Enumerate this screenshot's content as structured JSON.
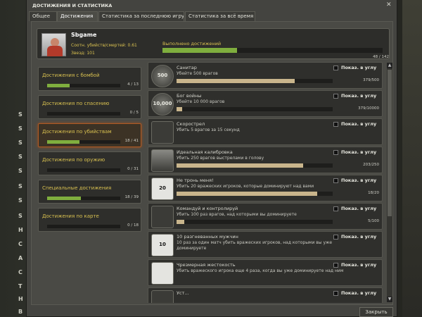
{
  "window": {
    "title": "ДОСТИЖЕНИЯ И СТАТИСТИКА",
    "close_label": "Закрыть"
  },
  "tabs": [
    {
      "label": "Общее"
    },
    {
      "label": "Достижения"
    },
    {
      "label": "Статистика за последнюю игру"
    },
    {
      "label": "Статистика за всё время"
    }
  ],
  "background_menu": [
    "S",
    "S",
    "S",
    "S",
    "S",
    "S",
    "S",
    "S",
    "H",
    "C",
    "A",
    "C",
    "T",
    "H",
    "B"
  ],
  "profile": {
    "name": "Sbgame",
    "kd_label": "Соотн. убийств/смертей: 0.61",
    "stars_label": "Звезд: 101",
    "achievements_label": "Выполнено достижений",
    "achievements_count": "48 / 142",
    "achievements_progress": 0.338
  },
  "categories": [
    {
      "label": "Достижения с бомбой",
      "count": "4 / 13",
      "progress": 0.308
    },
    {
      "label": "Достижения по спасению",
      "count": "0 / 5",
      "progress": 0
    },
    {
      "label": "Достижения по убийствам",
      "count": "18 / 41",
      "progress": 0.439
    },
    {
      "label": "Достижения по оружию",
      "count": "0 / 31",
      "progress": 0
    },
    {
      "label": "Специальные достижения",
      "count": "18 / 39",
      "progress": 0.462
    },
    {
      "label": "Достижения по карте",
      "count": "0 / 18",
      "progress": 0
    }
  ],
  "show_in_corner_label": "Показ. в углу",
  "achievements": [
    {
      "icon": "500",
      "title": "Санитар",
      "desc": "Убейте 500 врагов",
      "count": "379/500",
      "progress": 0.758
    },
    {
      "icon": "10,000",
      "title": "Бог войны",
      "desc": "Убейте 10 000 врагов",
      "count": "379/10000",
      "progress": 0.038
    },
    {
      "icon": "",
      "title": "Скорострел",
      "desc": "Убить 5 врагов за 15 секунд",
      "count": "",
      "progress": null
    },
    {
      "icon": "",
      "title": "Идеальная калибровка",
      "desc": "Убить 250 врагов выстрелами в голову",
      "count": "203/250",
      "progress": 0.812
    },
    {
      "icon": "20",
      "title": "Не тронь меня!",
      "desc": "Убить 20 вражеских игроков, которые доминируют над вами",
      "count": "18/20",
      "progress": 0.9
    },
    {
      "icon": "",
      "title": "Командуй и контролируй",
      "desc": "Убить 100 раз врагов, над которыми вы доминируете",
      "count": "5/100",
      "progress": 0.05
    },
    {
      "icon": "10",
      "title": "10 разгневанных мужчин",
      "desc": "10 раз за один матч убить вражеских игроков, над которыми вы уже",
      "desc2": "доминируете",
      "count": "",
      "progress": null
    },
    {
      "icon": "",
      "title": "Чрезмерная жестокость",
      "desc": "Убить вражеского игрока еще 4 раза, когда вы уже доминируете над ним",
      "count": "",
      "progress": null
    },
    {
      "icon": "",
      "title": "Уст...",
      "desc": "",
      "count": "",
      "progress": null
    }
  ],
  "colors": {
    "accent_green": "#7fae3e",
    "gold_text": "#d8c050",
    "progress_tan": "#c9b58c",
    "selected_border": "#b05a24"
  }
}
